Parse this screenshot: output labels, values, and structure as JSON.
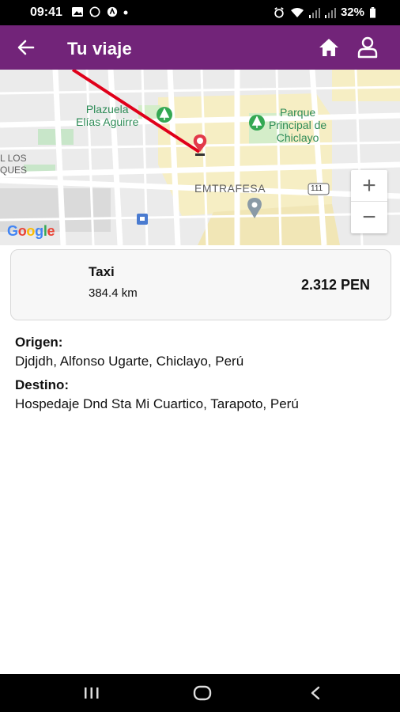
{
  "status_bar": {
    "time": "09:41",
    "battery": "32%",
    "left_icons": [
      "gallery-icon",
      "whatsapp-icon",
      "maps-icon",
      "dot-icon"
    ],
    "right_icons": [
      "alarm-icon",
      "wifi-icon",
      "signal-icon",
      "signal-icon",
      "battery-icon"
    ]
  },
  "app_bar": {
    "title": "Tu viaje",
    "background": "#722479",
    "back_icon": "arrow-left-icon",
    "home_icon": "home-icon",
    "profile_icon": "user-icon"
  },
  "map": {
    "labels": {
      "plazuela": "Plazuela\nElías Aguirre",
      "parque": "Parque\nPrincipal de\nChiclayo",
      "emtrafesa": "EMTRAFESA",
      "los_ques": "L LOS\nQUES",
      "route_shield": "111"
    },
    "zoom_in": "+",
    "zoom_out": "−",
    "attribution": [
      "G",
      "o",
      "o",
      "g",
      "l",
      "e"
    ],
    "route_color": "#e0001a",
    "marker_icon": "location-pin-icon"
  },
  "trip": {
    "vehicle_type": "Taxi",
    "distance": "384.4 km",
    "price": "2.312 PEN"
  },
  "origin": {
    "label": "Origen:",
    "value": "Djdjdh, Alfonso Ugarte, Chiclayo, Perú"
  },
  "destination": {
    "label": "Destino:",
    "value": "Hospedaje Dnd Sta Mi Cuartico, Tarapoto, Perú"
  },
  "nav_bar": {
    "icons": [
      "recent-apps-icon",
      "home-circle-icon",
      "back-chevron-icon"
    ]
  }
}
